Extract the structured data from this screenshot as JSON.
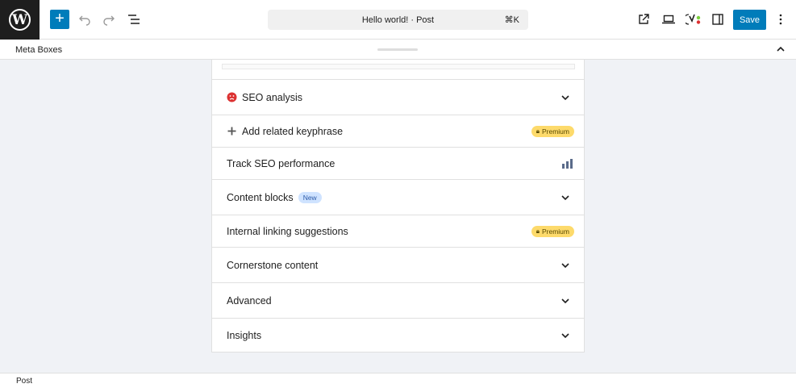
{
  "toolbar": {
    "logo_letter": "W",
    "add_label": "+",
    "document_title": "Hello world! · Post",
    "shortcut": "⌘K",
    "save_label": "Save",
    "icons": [
      "wordpress-logo",
      "plus-icon",
      "undo-icon",
      "redo-icon",
      "list-view-icon",
      "external-link-icon",
      "device-preview-icon",
      "yoast-icon",
      "sidebar-toggle-icon",
      "more-options-icon"
    ],
    "accent_color": "#007cba"
  },
  "metabar": {
    "label": "Meta Boxes"
  },
  "panel": {
    "rows": [
      {
        "label": "SEO analysis",
        "icon": "sad-face-icon",
        "status_color": "#dc3232"
      },
      {
        "label": "Add related keyphrase",
        "icon": "plus-icon",
        "badge": "Premium"
      },
      {
        "label": "Track SEO performance",
        "icon": "bar-chart-icon"
      },
      {
        "label": "Content blocks",
        "badge": "New"
      },
      {
        "label": "Internal linking suggestions",
        "badge": "Premium"
      },
      {
        "label": "Cornerstone content"
      },
      {
        "label": "Advanced"
      },
      {
        "label": "Insights"
      }
    ]
  },
  "statusbar": {
    "label": "Post"
  }
}
